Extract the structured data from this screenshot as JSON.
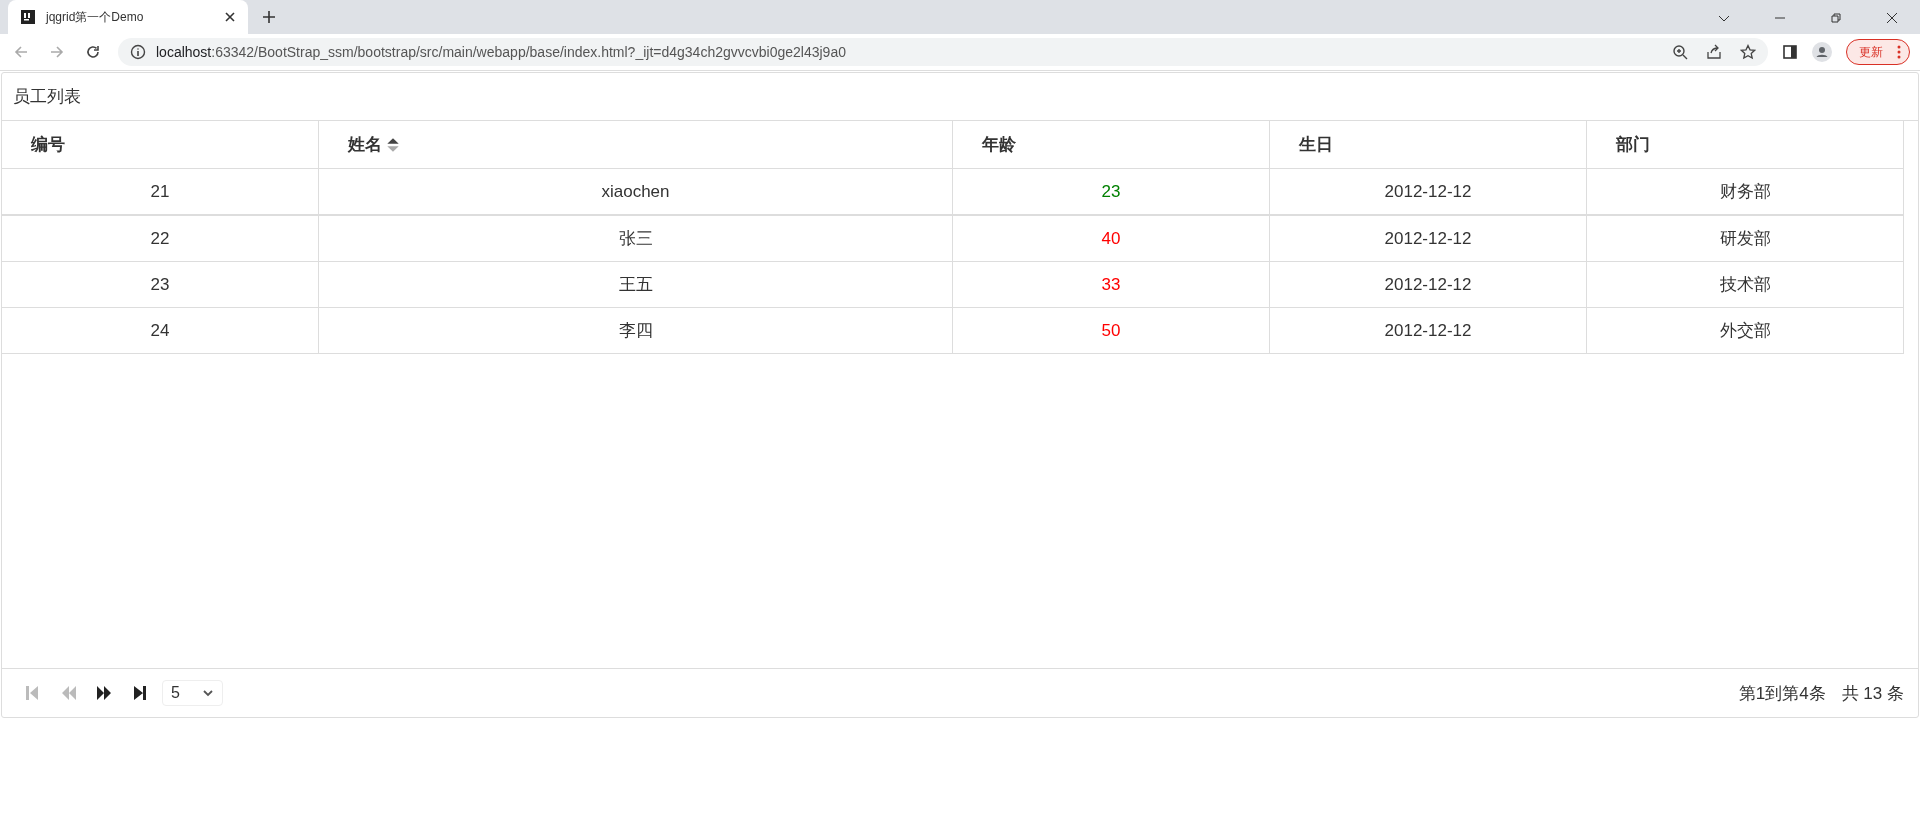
{
  "browser": {
    "tab_title": "jqgrid第一个Demo",
    "url_host": "localhost",
    "url_rest": ":63342/BootStrap_ssm/bootstrap/src/main/webapp/base/index.html?_ijt=d4g34ch2gvvcvbi0ge2l43j9a0",
    "update_button": "更新"
  },
  "grid": {
    "caption": "员工列表",
    "columns": [
      {
        "label": "编号",
        "sortable": false
      },
      {
        "label": "姓名",
        "sortable": true
      },
      {
        "label": "年龄",
        "sortable": false
      },
      {
        "label": "生日",
        "sortable": false
      },
      {
        "label": "部门",
        "sortable": false
      }
    ],
    "rows": [
      {
        "id": "21",
        "name": "xiaochen",
        "age": "23",
        "color": "#008000",
        "birthday": "2012-12-12",
        "department": "财务部"
      },
      {
        "id": "22",
        "name": "张三",
        "age": "40",
        "color": "#ff0000",
        "birthday": "2012-12-12",
        "department": "研发部"
      },
      {
        "id": "23",
        "name": "王五",
        "age": "33",
        "color": "#ff0000",
        "birthday": "2012-12-12",
        "department": "技术部"
      },
      {
        "id": "24",
        "name": "李四",
        "age": "50",
        "color": "#ff0000",
        "birthday": "2012-12-12",
        "department": "外交部"
      }
    ],
    "pager": {
      "buttons": [
        {
          "kind": "first",
          "disabled": true
        },
        {
          "kind": "prev",
          "disabled": true
        },
        {
          "kind": "next",
          "disabled": false
        },
        {
          "kind": "last",
          "disabled": false
        }
      ],
      "page_size": "5",
      "range": "第1到第4条",
      "total": "共 13 条"
    }
  }
}
